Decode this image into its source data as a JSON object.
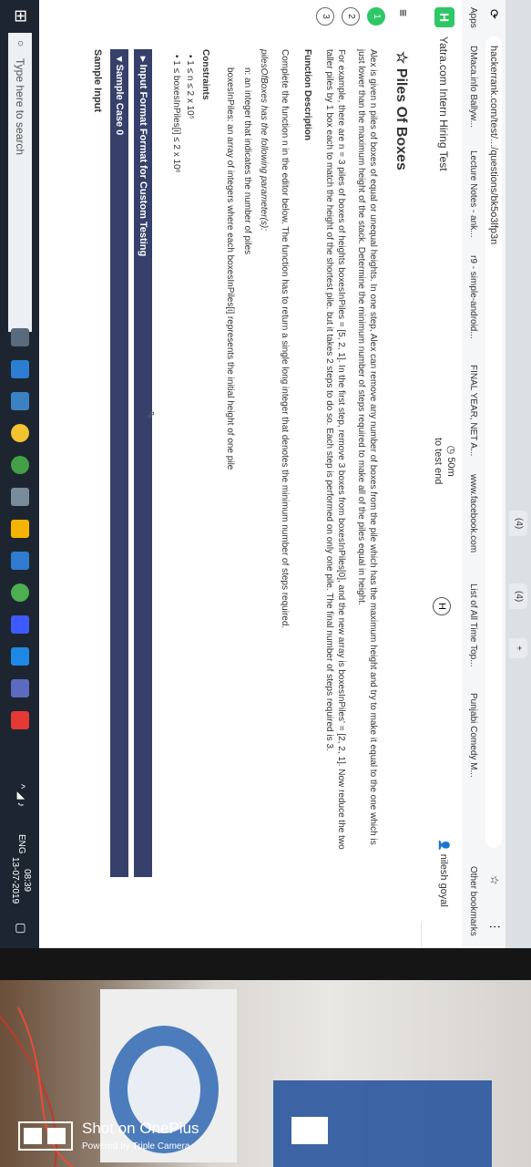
{
  "browser": {
    "tabs": [
      "Apps",
      "DMaca.info Ballyw...",
      "Lecture Notes - ank...",
      "r9 - simple-android...",
      "FINAL YEAR, NET A...",
      "www.facebook.com",
      "List of All Time Top...",
      "Punjabi Comedy M...",
      "Other bookmarks"
    ],
    "url": "hackerrank.com/test/.../questions/bk5o3lfp3n",
    "top_tabs": [
      "(4)",
      "(4)",
      "+"
    ]
  },
  "header": {
    "logo": "H",
    "test_name": "Yatra.com Intern Hiring Test",
    "timer": "50m",
    "timer_sub": "to test end",
    "user": "nilesh goyal"
  },
  "rail": {
    "questions": [
      "1",
      "2",
      "3"
    ]
  },
  "problem": {
    "title": "Piles Of Boxes",
    "para1_line1": "Alex is given n piles of boxes of equal or unequal heights. In one step, Alex can remove any number of boxes from the pile which has the maximum height and try to make it equal to the one which is",
    "para1_line2": "just lower than the maximum height of the stack. Determine the minimum number of steps required to make all of the piles equal in height.",
    "para2_line1": "For example, there are n = 3 piles of boxes of heights boxesInPiles = [5, 2, 1]. In the first step, remove 3 boxes from boxesInPiles[0], and the new array is boxesInPiles' = [2, 2, 1]. Now reduce the two",
    "para2_line2": "taller piles by 1 box each to match the height of the shortest pile. but it takes 2 steps to do so.  Each step is performed on only one pile. The final number of steps required is 3.",
    "fd_heading": "Function Description",
    "fd_line": "Complete the function n in the editor below. The function has to return a single long integer that denotes the minimum number of steps required.",
    "params_intro": "pilesOfBoxes has the following parameter(s):",
    "param1": "n: an integer that indicates the number of piles",
    "param2": "boxesInPiles: an array of integers where each boxesInPiles[i] represents the initial height of one pile",
    "constraints_heading": "Constraints",
    "constraint1": "1 ≤ n ≤ 2 x 10⁵",
    "constraint2": "1 ≤ boxesInPiles[i] ≤ 2 x 10⁶",
    "input_format": "▸ Input Format Format for Custom Testing",
    "sample_case": "▾ Sample Case 0",
    "sample_input": "Sample Input"
  },
  "taskbar": {
    "search_placeholder": "Type here to search",
    "lang": "ENG",
    "time": "08:39",
    "date": "13-07-2019"
  },
  "watermark": {
    "line1": "Shot on OnePlus",
    "line2": "Powered by Triple Camera"
  },
  "colors": {
    "hr_green": "#2ec866",
    "section_bar": "#36406b",
    "taskbar": "#1d2630"
  }
}
